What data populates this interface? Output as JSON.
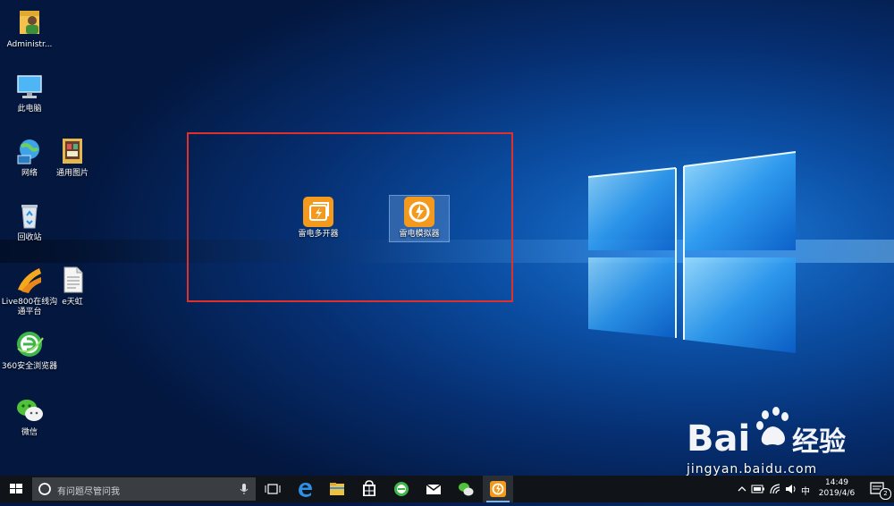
{
  "desktop": {
    "icons": [
      {
        "label": "Administr..."
      },
      {
        "label": "此电脑"
      },
      {
        "label": "网络"
      },
      {
        "label": "通用图片"
      },
      {
        "label": "回收站"
      },
      {
        "label": "Live800在线沟通平台"
      },
      {
        "label": "e天虹"
      },
      {
        "label": "360安全浏览器"
      },
      {
        "label": "微信"
      },
      {
        "label": "雷电多开器"
      },
      {
        "label": "雷电模拟器"
      }
    ]
  },
  "watermark": {
    "brand_text": "jingyan.baidu.com"
  },
  "taskbar": {
    "search_placeholder": "有问题尽管问我",
    "ime_label": "中",
    "clock_time": "14:49",
    "clock_date": "2019/4/6",
    "notification_count": "2"
  },
  "colors": {
    "highlight_box": "#e0302c",
    "taskbar_bg": "#101418",
    "ldplayer_orange": "#f39a1e"
  }
}
